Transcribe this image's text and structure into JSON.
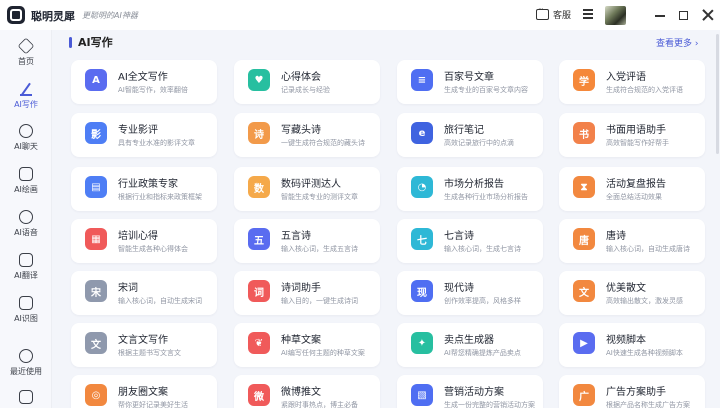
{
  "app": {
    "name": "聪明灵犀",
    "slogan": "更聪明的AI神器"
  },
  "titlebar": {
    "service_label": "客服"
  },
  "sidebar": {
    "items": [
      {
        "label": "首页",
        "icon": "hexagon-home-icon",
        "active": false
      },
      {
        "label": "AI写作",
        "icon": "pen-icon",
        "active": true
      },
      {
        "label": "AI聊天",
        "icon": "chat-bubble-icon",
        "active": false
      },
      {
        "label": "AI绘画",
        "icon": "brush-icon",
        "active": false
      },
      {
        "label": "AI语音",
        "icon": "headphones-icon",
        "active": false
      },
      {
        "label": "AI翻译",
        "icon": "translate-icon",
        "active": false
      },
      {
        "label": "AI识图",
        "icon": "scan-image-icon",
        "active": false
      },
      {
        "label": "最近使用",
        "icon": "clock-icon",
        "active": false
      }
    ]
  },
  "section": {
    "title": "AI写作",
    "more_label": "查看更多 ›"
  },
  "colors": {
    "accent": "#4a5ad6",
    "card_bg": "#ffffff",
    "page_bg": "#f3f5fa"
  },
  "cards": [
    {
      "title": "AI全文写作",
      "desc": "AI智能写作，效率翻倍",
      "icon": "ai-document-icon",
      "glyph": "A",
      "color": "#5a6cf0"
    },
    {
      "title": "心得体会",
      "desc": "记录成长与经验",
      "icon": "notebook-icon",
      "glyph": "♥",
      "color": "#27bfa0"
    },
    {
      "title": "百家号文章",
      "desc": "生成专业的百家号文章内容",
      "icon": "article-icon",
      "glyph": "≡",
      "color": "#4f6ef2"
    },
    {
      "title": "入党评语",
      "desc": "生成符合规范的入党评语",
      "icon": "party-icon",
      "glyph": "学",
      "color": "#f5883a"
    },
    {
      "title": "专业影评",
      "desc": "具有专业水准的影评文章",
      "icon": "film-icon",
      "glyph": "影",
      "color": "#4e7ef5"
    },
    {
      "title": "写藏头诗",
      "desc": "一键生成符合规范的藏头诗",
      "icon": "poem-icon",
      "glyph": "诗",
      "color": "#f29a4a"
    },
    {
      "title": "旅行笔记",
      "desc": "高效记录旅行中的点滴",
      "icon": "travel-icon",
      "glyph": "e",
      "color": "#3f63e0"
    },
    {
      "title": "书面用语助手",
      "desc": "高效智能写作好帮手",
      "icon": "book-icon",
      "glyph": "书",
      "color": "#f2814a"
    },
    {
      "title": "行业政策专家",
      "desc": "根据行业和指标来政策框架",
      "icon": "policy-icon",
      "glyph": "▤",
      "color": "#4e7ef5"
    },
    {
      "title": "数码评测达人",
      "desc": "智能生成专业的测评文章",
      "icon": "digital-icon",
      "glyph": "数",
      "color": "#f5a94a"
    },
    {
      "title": "市场分析报告",
      "desc": "生成各种行业市场分析报告",
      "icon": "chart-pie-icon",
      "glyph": "◔",
      "color": "#2eb8d6"
    },
    {
      "title": "活动复盘报告",
      "desc": "全面总结活动效果",
      "icon": "hourglass-icon",
      "glyph": "⧗",
      "color": "#f2883f"
    },
    {
      "title": "培训心得",
      "desc": "智能生成各种心得体会",
      "icon": "training-icon",
      "glyph": "▦",
      "color": "#f05a5a"
    },
    {
      "title": "五言诗",
      "desc": "输入核心词，生成五言诗",
      "icon": "five-poem-icon",
      "glyph": "五",
      "color": "#5a6cf0"
    },
    {
      "title": "七言诗",
      "desc": "输入核心词，生成七言诗",
      "icon": "seven-poem-icon",
      "glyph": "七",
      "color": "#2eb8d6"
    },
    {
      "title": "唐诗",
      "desc": "输入核心词，自动生成唐诗",
      "icon": "tang-poem-icon",
      "glyph": "唐",
      "color": "#f2883f"
    },
    {
      "title": "宋词",
      "desc": "输入核心词，自动生成宋词",
      "icon": "song-ci-icon",
      "glyph": "宋",
      "color": "#8f99ad"
    },
    {
      "title": "诗词助手",
      "desc": "输入目的，一键生成诗词",
      "icon": "poetry-assistant-icon",
      "glyph": "词",
      "color": "#f05a5a"
    },
    {
      "title": "现代诗",
      "desc": "创作效率提高，风格多样",
      "icon": "modern-poem-icon",
      "glyph": "现",
      "color": "#4f6ef2"
    },
    {
      "title": "优美散文",
      "desc": "高效输出散文，激发灵感",
      "icon": "prose-icon",
      "glyph": "文",
      "color": "#f2883f"
    },
    {
      "title": "文言文写作",
      "desc": "根据主题书写文言文",
      "icon": "classical-icon",
      "glyph": "文",
      "color": "#8f99ad"
    },
    {
      "title": "种草文案",
      "desc": "AI编写任何主题的种草文案",
      "icon": "seedling-icon",
      "glyph": "❦",
      "color": "#f05a5a"
    },
    {
      "title": "卖点生成器",
      "desc": "AI帮您精确提炼产品卖点",
      "icon": "selling-point-icon",
      "glyph": "✦",
      "color": "#27bfa0"
    },
    {
      "title": "视频脚本",
      "desc": "AI快速生成各种视频脚本",
      "icon": "video-script-icon",
      "glyph": "▶",
      "color": "#5a6cf0"
    },
    {
      "title": "朋友圈文案",
      "desc": "帮你更好记录美好生活",
      "icon": "moments-icon",
      "glyph": "◎",
      "color": "#f2883f"
    },
    {
      "title": "微博推文",
      "desc": "紧跟时事热点，博主必备",
      "icon": "weibo-icon",
      "glyph": "微",
      "color": "#f05a5a"
    },
    {
      "title": "营销活动方案",
      "desc": "生成一份完整的营销活动方案",
      "icon": "marketing-icon",
      "glyph": "▧",
      "color": "#4f6ef2"
    },
    {
      "title": "广告方案助手",
      "desc": "根据产品名称生成广告方案",
      "icon": "ad-icon",
      "glyph": "广",
      "color": "#f2883f"
    }
  ]
}
